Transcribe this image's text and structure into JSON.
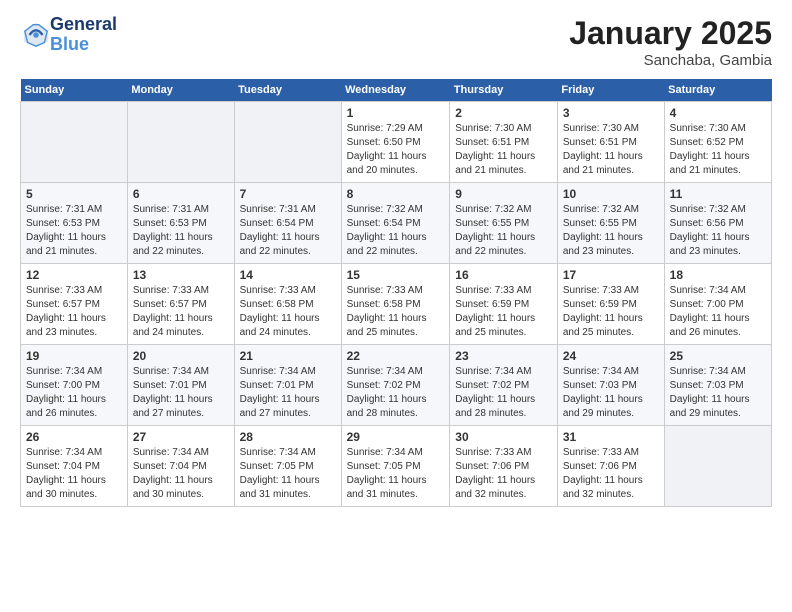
{
  "logo": {
    "line1": "General",
    "line2": "Blue"
  },
  "title": "January 2025",
  "location": "Sanchaba, Gambia",
  "weekdays": [
    "Sunday",
    "Monday",
    "Tuesday",
    "Wednesday",
    "Thursday",
    "Friday",
    "Saturday"
  ],
  "weeks": [
    [
      {
        "day": "",
        "sunrise": "",
        "sunset": "",
        "daylight": ""
      },
      {
        "day": "",
        "sunrise": "",
        "sunset": "",
        "daylight": ""
      },
      {
        "day": "",
        "sunrise": "",
        "sunset": "",
        "daylight": ""
      },
      {
        "day": "1",
        "sunrise": "Sunrise: 7:29 AM",
        "sunset": "Sunset: 6:50 PM",
        "daylight": "Daylight: 11 hours and 20 minutes."
      },
      {
        "day": "2",
        "sunrise": "Sunrise: 7:30 AM",
        "sunset": "Sunset: 6:51 PM",
        "daylight": "Daylight: 11 hours and 21 minutes."
      },
      {
        "day": "3",
        "sunrise": "Sunrise: 7:30 AM",
        "sunset": "Sunset: 6:51 PM",
        "daylight": "Daylight: 11 hours and 21 minutes."
      },
      {
        "day": "4",
        "sunrise": "Sunrise: 7:30 AM",
        "sunset": "Sunset: 6:52 PM",
        "daylight": "Daylight: 11 hours and 21 minutes."
      }
    ],
    [
      {
        "day": "5",
        "sunrise": "Sunrise: 7:31 AM",
        "sunset": "Sunset: 6:53 PM",
        "daylight": "Daylight: 11 hours and 21 minutes."
      },
      {
        "day": "6",
        "sunrise": "Sunrise: 7:31 AM",
        "sunset": "Sunset: 6:53 PM",
        "daylight": "Daylight: 11 hours and 22 minutes."
      },
      {
        "day": "7",
        "sunrise": "Sunrise: 7:31 AM",
        "sunset": "Sunset: 6:54 PM",
        "daylight": "Daylight: 11 hours and 22 minutes."
      },
      {
        "day": "8",
        "sunrise": "Sunrise: 7:32 AM",
        "sunset": "Sunset: 6:54 PM",
        "daylight": "Daylight: 11 hours and 22 minutes."
      },
      {
        "day": "9",
        "sunrise": "Sunrise: 7:32 AM",
        "sunset": "Sunset: 6:55 PM",
        "daylight": "Daylight: 11 hours and 22 minutes."
      },
      {
        "day": "10",
        "sunrise": "Sunrise: 7:32 AM",
        "sunset": "Sunset: 6:55 PM",
        "daylight": "Daylight: 11 hours and 23 minutes."
      },
      {
        "day": "11",
        "sunrise": "Sunrise: 7:32 AM",
        "sunset": "Sunset: 6:56 PM",
        "daylight": "Daylight: 11 hours and 23 minutes."
      }
    ],
    [
      {
        "day": "12",
        "sunrise": "Sunrise: 7:33 AM",
        "sunset": "Sunset: 6:57 PM",
        "daylight": "Daylight: 11 hours and 23 minutes."
      },
      {
        "day": "13",
        "sunrise": "Sunrise: 7:33 AM",
        "sunset": "Sunset: 6:57 PM",
        "daylight": "Daylight: 11 hours and 24 minutes."
      },
      {
        "day": "14",
        "sunrise": "Sunrise: 7:33 AM",
        "sunset": "Sunset: 6:58 PM",
        "daylight": "Daylight: 11 hours and 24 minutes."
      },
      {
        "day": "15",
        "sunrise": "Sunrise: 7:33 AM",
        "sunset": "Sunset: 6:58 PM",
        "daylight": "Daylight: 11 hours and 25 minutes."
      },
      {
        "day": "16",
        "sunrise": "Sunrise: 7:33 AM",
        "sunset": "Sunset: 6:59 PM",
        "daylight": "Daylight: 11 hours and 25 minutes."
      },
      {
        "day": "17",
        "sunrise": "Sunrise: 7:33 AM",
        "sunset": "Sunset: 6:59 PM",
        "daylight": "Daylight: 11 hours and 25 minutes."
      },
      {
        "day": "18",
        "sunrise": "Sunrise: 7:34 AM",
        "sunset": "Sunset: 7:00 PM",
        "daylight": "Daylight: 11 hours and 26 minutes."
      }
    ],
    [
      {
        "day": "19",
        "sunrise": "Sunrise: 7:34 AM",
        "sunset": "Sunset: 7:00 PM",
        "daylight": "Daylight: 11 hours and 26 minutes."
      },
      {
        "day": "20",
        "sunrise": "Sunrise: 7:34 AM",
        "sunset": "Sunset: 7:01 PM",
        "daylight": "Daylight: 11 hours and 27 minutes."
      },
      {
        "day": "21",
        "sunrise": "Sunrise: 7:34 AM",
        "sunset": "Sunset: 7:01 PM",
        "daylight": "Daylight: 11 hours and 27 minutes."
      },
      {
        "day": "22",
        "sunrise": "Sunrise: 7:34 AM",
        "sunset": "Sunset: 7:02 PM",
        "daylight": "Daylight: 11 hours and 28 minutes."
      },
      {
        "day": "23",
        "sunrise": "Sunrise: 7:34 AM",
        "sunset": "Sunset: 7:02 PM",
        "daylight": "Daylight: 11 hours and 28 minutes."
      },
      {
        "day": "24",
        "sunrise": "Sunrise: 7:34 AM",
        "sunset": "Sunset: 7:03 PM",
        "daylight": "Daylight: 11 hours and 29 minutes."
      },
      {
        "day": "25",
        "sunrise": "Sunrise: 7:34 AM",
        "sunset": "Sunset: 7:03 PM",
        "daylight": "Daylight: 11 hours and 29 minutes."
      }
    ],
    [
      {
        "day": "26",
        "sunrise": "Sunrise: 7:34 AM",
        "sunset": "Sunset: 7:04 PM",
        "daylight": "Daylight: 11 hours and 30 minutes."
      },
      {
        "day": "27",
        "sunrise": "Sunrise: 7:34 AM",
        "sunset": "Sunset: 7:04 PM",
        "daylight": "Daylight: 11 hours and 30 minutes."
      },
      {
        "day": "28",
        "sunrise": "Sunrise: 7:34 AM",
        "sunset": "Sunset: 7:05 PM",
        "daylight": "Daylight: 11 hours and 31 minutes."
      },
      {
        "day": "29",
        "sunrise": "Sunrise: 7:34 AM",
        "sunset": "Sunset: 7:05 PM",
        "daylight": "Daylight: 11 hours and 31 minutes."
      },
      {
        "day": "30",
        "sunrise": "Sunrise: 7:33 AM",
        "sunset": "Sunset: 7:06 PM",
        "daylight": "Daylight: 11 hours and 32 minutes."
      },
      {
        "day": "31",
        "sunrise": "Sunrise: 7:33 AM",
        "sunset": "Sunset: 7:06 PM",
        "daylight": "Daylight: 11 hours and 32 minutes."
      },
      {
        "day": "",
        "sunrise": "",
        "sunset": "",
        "daylight": ""
      }
    ]
  ]
}
